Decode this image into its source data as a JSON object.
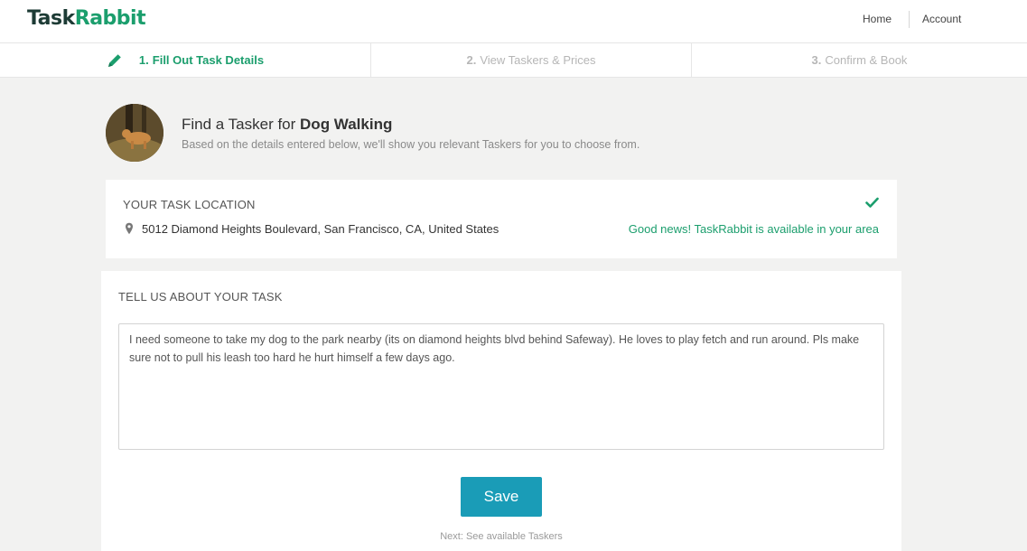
{
  "header": {
    "logo_part1": "Task",
    "logo_part2": "Rabbit",
    "nav_home": "Home",
    "nav_account": "Account"
  },
  "steps": [
    {
      "num": "1.",
      "label": "Fill Out Task Details",
      "active": true
    },
    {
      "num": "2.",
      "label": "View Taskers & Prices",
      "active": false
    },
    {
      "num": "3.",
      "label": "Confirm & Book",
      "active": false
    }
  ],
  "hero": {
    "title_prefix": "Find a Tasker for ",
    "title_task": "Dog Walking",
    "subtitle": "Based on the details entered below, we'll show you relevant Taskers for you to choose from."
  },
  "location": {
    "heading": "YOUR TASK LOCATION",
    "address": "5012 Diamond Heights Boulevard, San Francisco, CA, United States",
    "status": "Good news! TaskRabbit is available in your area"
  },
  "task": {
    "heading": "TELL US ABOUT YOUR TASK",
    "description": "I need someone to take my dog to the park nearby (its on diamond heights blvd behind Safeway). He loves to play fetch and run around. Pls make sure not to pull his leash too hard he hurt himself a few days ago.",
    "save_label": "Save",
    "next_text": "Next: See available Taskers"
  },
  "colors": {
    "brand_green": "#1b9e6d",
    "save_blue": "#1a9cb7",
    "page_bg": "#f2f2f1"
  },
  "icons": {
    "step_active": "pencil-icon",
    "location_ok": "checkmark-icon",
    "address": "map-pin-icon"
  }
}
